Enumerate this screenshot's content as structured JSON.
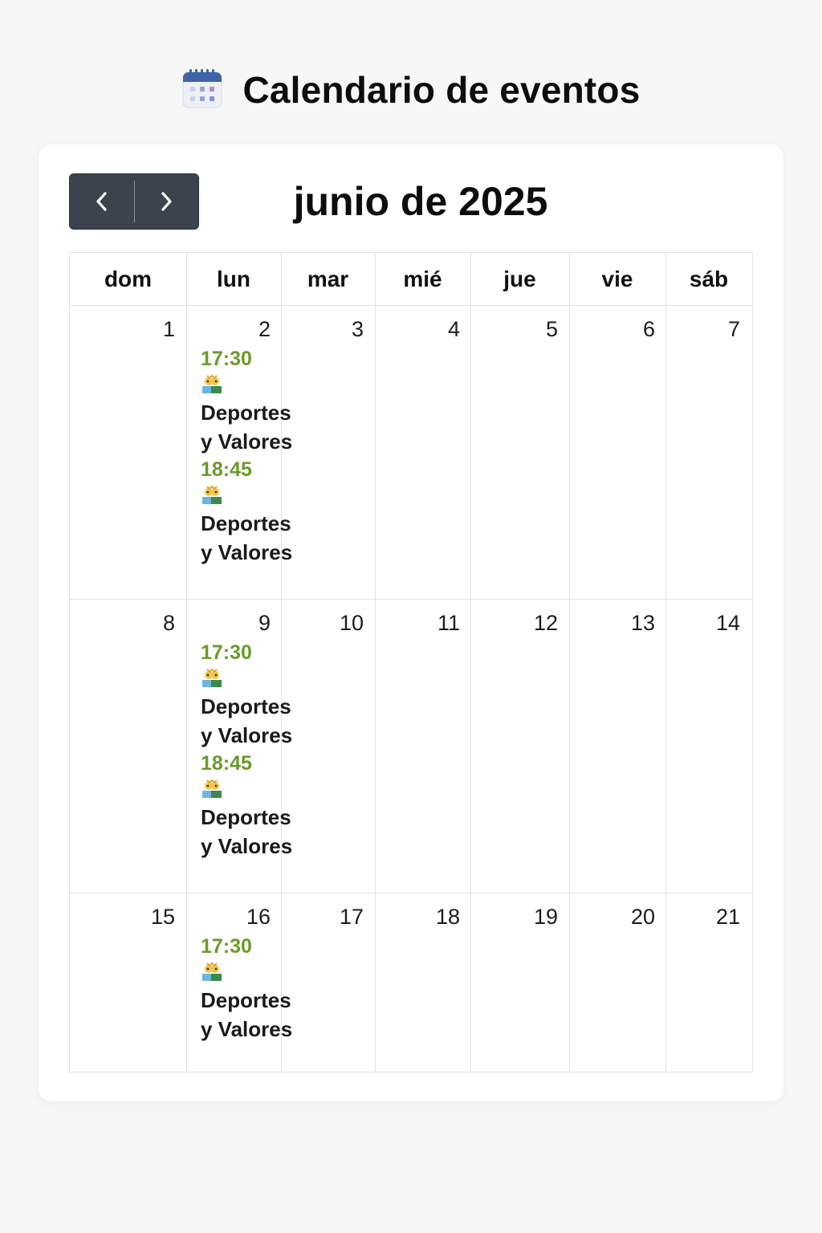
{
  "header": {
    "title": "Calendario de eventos",
    "icon": "calendar-icon"
  },
  "toolbar": {
    "prev_icon": "chevron-left-icon",
    "next_icon": "chevron-right-icon",
    "month_title": "junio de 2025"
  },
  "weekdays": [
    "dom",
    "lun",
    "mar",
    "mié",
    "jue",
    "vie",
    "sáb"
  ],
  "weeks": [
    [
      "1",
      "2",
      "3",
      "4",
      "5",
      "6",
      "7"
    ],
    [
      "8",
      "9",
      "10",
      "11",
      "12",
      "13",
      "14"
    ],
    [
      "15",
      "16",
      "17",
      "18",
      "19",
      "20",
      "21"
    ]
  ],
  "events": {
    "w0": [
      {
        "time": "17:30",
        "title_line1": "Deportes",
        "title_line2": "y Valores",
        "icon": "kids-icon"
      },
      {
        "time": "18:45",
        "title_line1": "Deportes",
        "title_line2": "y Valores",
        "icon": "kids-icon"
      }
    ],
    "w1": [
      {
        "time": "17:30",
        "title_line1": "Deportes",
        "title_line2": "y Valores",
        "icon": "kids-icon"
      },
      {
        "time": "18:45",
        "title_line1": "Deportes",
        "title_line2": "y Valores",
        "icon": "kids-icon"
      }
    ],
    "w2": [
      {
        "time": "17:30",
        "title_line1": "Deportes",
        "title_line2": "y Valores",
        "icon": "kids-icon"
      }
    ]
  },
  "colors": {
    "event_time": "#6a9b2a",
    "nav_background": "#3b444d"
  }
}
